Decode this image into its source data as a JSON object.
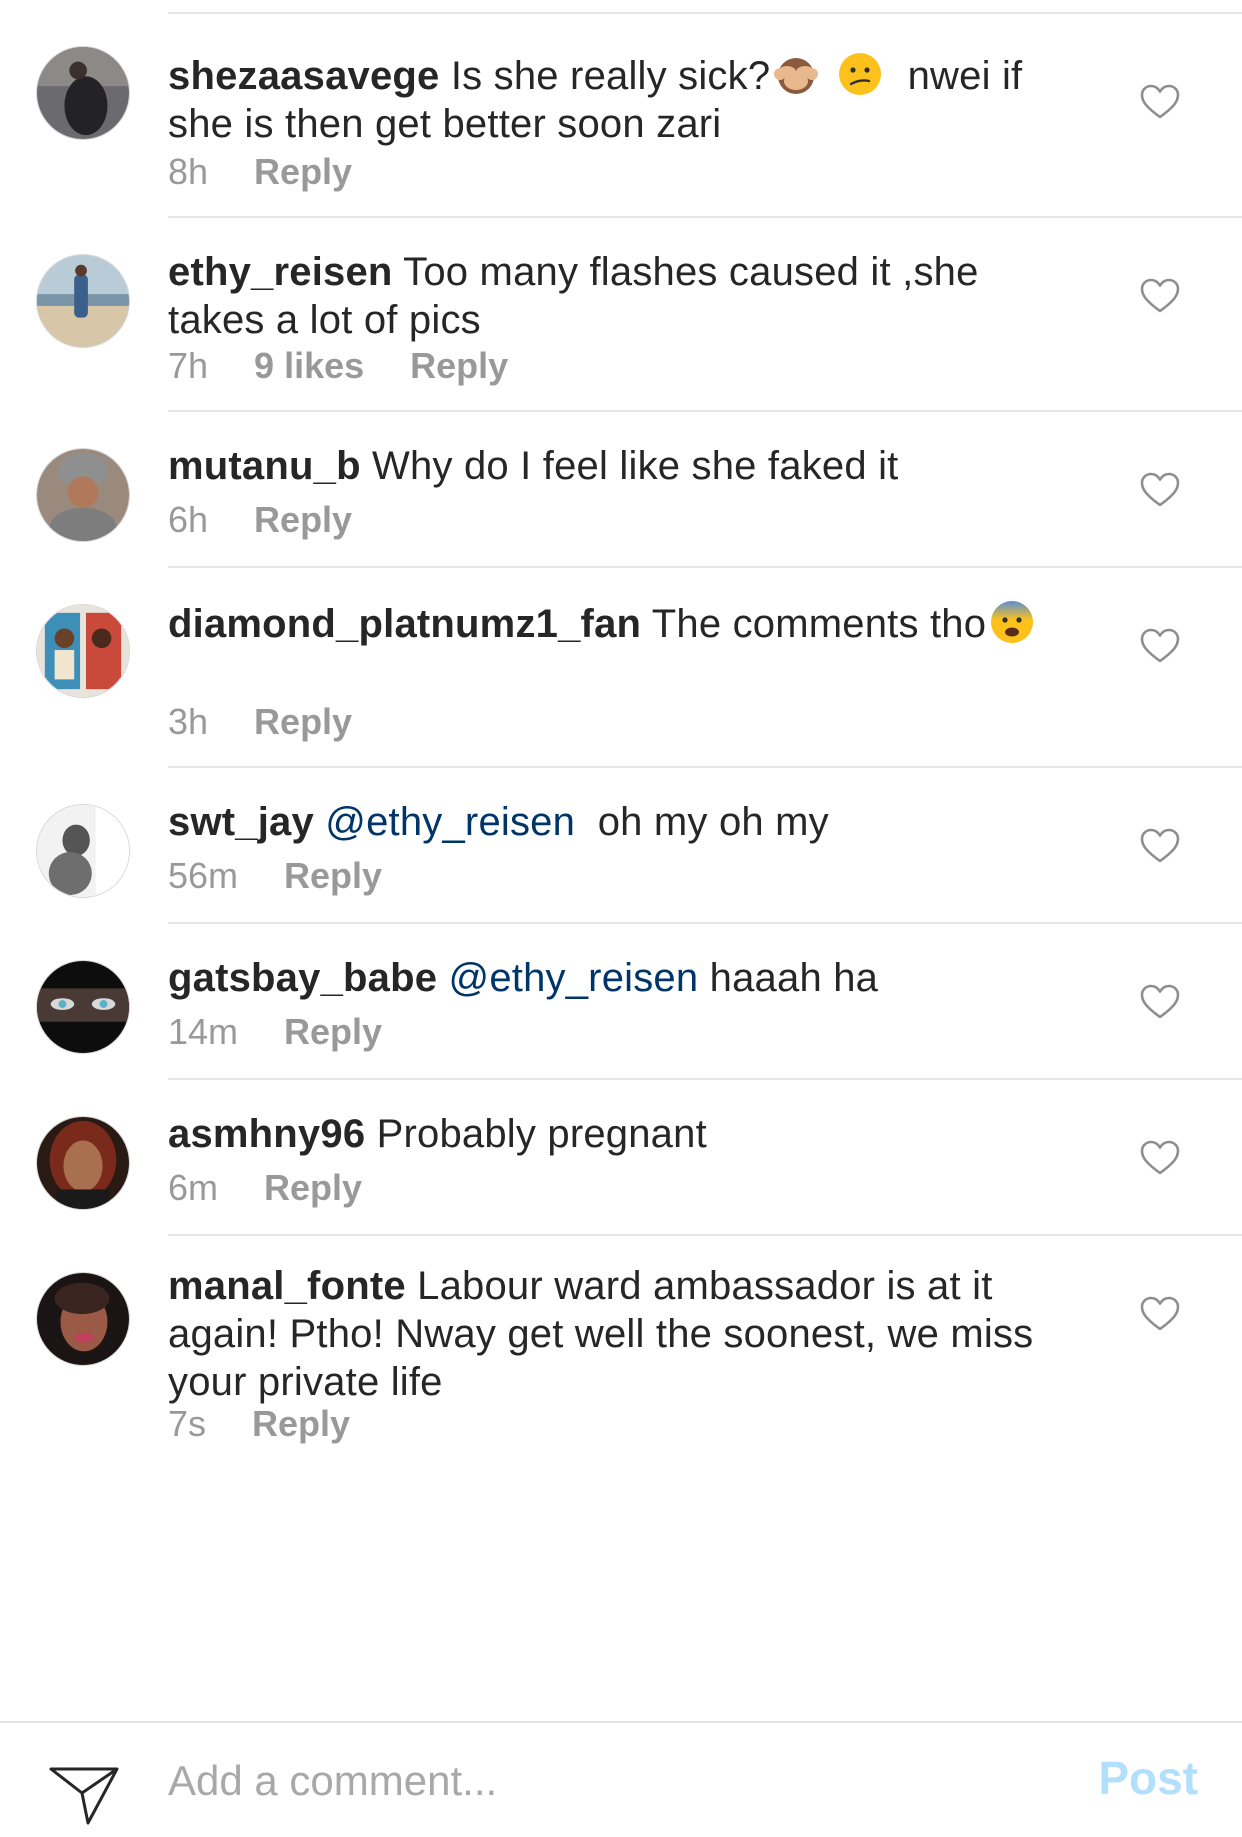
{
  "comments": [
    {
      "username": "shezaasavege",
      "text_a": "Is she really sick?",
      "text_b": " nwei if she is then get better soon zari",
      "time": "8h",
      "reply": "Reply"
    },
    {
      "username": "ethy_reisen",
      "text": "Too many flashes caused it ,she takes a lot of pics",
      "time": "7h",
      "likes": "9 likes",
      "reply": "Reply"
    },
    {
      "username": "mutanu_b",
      "text": "Why do I feel like she faked it",
      "time": "6h",
      "reply": "Reply"
    },
    {
      "username": "diamond_platnumz1_fan",
      "text": "The comments tho",
      "time": "3h",
      "reply": "Reply"
    },
    {
      "username": "swt_jay",
      "mention": "@ethy_reisen",
      "text": "  oh my oh my",
      "time": "56m",
      "reply": "Reply"
    },
    {
      "username": "gatsbay_babe",
      "mention": "@ethy_reisen",
      "text": "haaah ha",
      "time": "14m",
      "reply": "Reply"
    },
    {
      "username": "asmhny96",
      "text": "Probably pregnant",
      "time": "6m",
      "reply": "Reply"
    },
    {
      "username": "manal_fonte",
      "text": "Labour ward ambassador is at it again! Ptho! Nway get well the soonest, we miss your private life",
      "time": "7s",
      "reply": "Reply"
    }
  ],
  "emojis": {
    "c1_first": "see-no-evil-monkey-emoji",
    "c1_second": "confused-face-emoji",
    "c4": "fearful-face-emoji"
  },
  "icons": {
    "like": "heart-outline-icon",
    "send": "paper-plane-icon"
  },
  "composer": {
    "placeholder": "Add a comment...",
    "post_label": "Post"
  },
  "colors": {
    "mention": "#003569",
    "meta": "#999999",
    "post_disabled": "#b2dffc"
  }
}
